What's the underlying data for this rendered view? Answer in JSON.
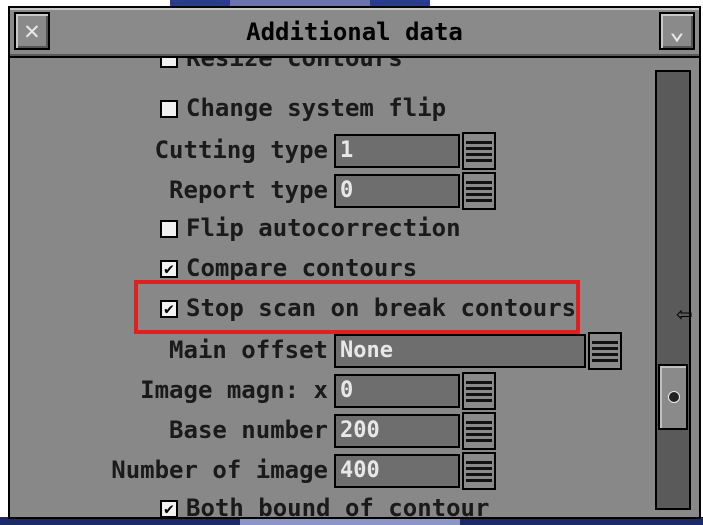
{
  "window": {
    "title": "Additional data",
    "close_glyph": "✕",
    "menu_glyph": "⌄"
  },
  "checkboxes": [
    {
      "label": "Resize contours",
      "checked": false
    },
    {
      "label": "Change system flip",
      "checked": false
    },
    {
      "label": "Flip autocorrection",
      "checked": false
    },
    {
      "label": "Compare contours",
      "checked": true
    },
    {
      "label": "Stop scan on break contours",
      "checked": true
    },
    {
      "label": "Both bound of contour",
      "checked": true
    }
  ],
  "fields": {
    "cutting_type": {
      "label": "Cutting type",
      "value": "1"
    },
    "report_type": {
      "label": "Report type",
      "value": "0"
    },
    "main_offset": {
      "label": "Main offset",
      "value": "None"
    },
    "image_magn": {
      "label": "Image magn: x",
      "value": "0"
    },
    "base_number": {
      "label": "Base number",
      "value": "200"
    },
    "number_of_image": {
      "label": "Number of image",
      "value": "400"
    }
  },
  "check_glyph": "✔",
  "icons": {
    "close": "close-icon",
    "menu": "chevron-down-icon",
    "spinner": "spinner-icon",
    "cursor": "arrow-cursor-icon"
  },
  "colors": {
    "window": "#888888",
    "highlight": "#e02020",
    "field": "#6e6e6e"
  },
  "scroll": {
    "position_fraction": 0.7
  },
  "cursor_glyph": "⇦"
}
